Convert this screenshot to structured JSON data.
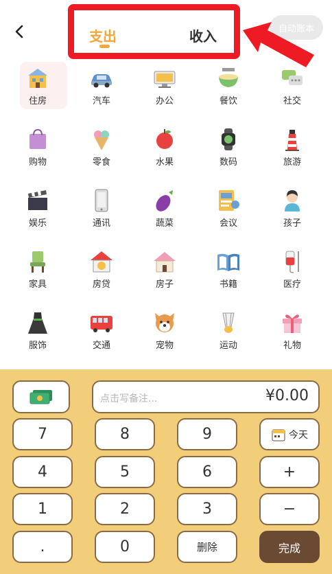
{
  "header": {
    "tabs": [
      {
        "label": "支出",
        "active": true
      },
      {
        "label": "收入",
        "active": false
      }
    ],
    "auto_button": "自动账本",
    "accent": "#f0a83a",
    "highlight_color": "#ee1b24"
  },
  "categories": [
    {
      "label": "住房",
      "icon": "house-icon",
      "selected": true
    },
    {
      "label": "汽车",
      "icon": "car-icon"
    },
    {
      "label": "办公",
      "icon": "computer-icon"
    },
    {
      "label": "餐饮",
      "icon": "noodle-bowl-icon"
    },
    {
      "label": "社交",
      "icon": "chat-bubbles-icon"
    },
    {
      "label": "购物",
      "icon": "shopping-bag-icon"
    },
    {
      "label": "零食",
      "icon": "ice-cream-icon"
    },
    {
      "label": "水果",
      "icon": "apple-icon"
    },
    {
      "label": "数码",
      "icon": "smartwatch-icon"
    },
    {
      "label": "旅游",
      "icon": "lighthouse-icon"
    },
    {
      "label": "娱乐",
      "icon": "clapperboard-icon"
    },
    {
      "label": "通讯",
      "icon": "phone-icon"
    },
    {
      "label": "蔬菜",
      "icon": "eggplant-icon"
    },
    {
      "label": "会议",
      "icon": "meeting-icon"
    },
    {
      "label": "孩子",
      "icon": "child-icon"
    },
    {
      "label": "家具",
      "icon": "chair-icon"
    },
    {
      "label": "房贷",
      "icon": "mortgage-house-icon"
    },
    {
      "label": "房子",
      "icon": "home-icon"
    },
    {
      "label": "书籍",
      "icon": "book-icon"
    },
    {
      "label": "医疗",
      "icon": "iv-drip-icon"
    },
    {
      "label": "服饰",
      "icon": "dress-icon"
    },
    {
      "label": "交通",
      "icon": "bus-icon"
    },
    {
      "label": "宠物",
      "icon": "dog-icon"
    },
    {
      "label": "运动",
      "icon": "shuttlecock-icon"
    },
    {
      "label": "礼物",
      "icon": "gift-icon"
    }
  ],
  "keypad": {
    "memo_placeholder": "点击写备注...",
    "amount": "¥0.00",
    "keys": {
      "k7": "7",
      "k8": "8",
      "k9": "9",
      "k4": "4",
      "k5": "5",
      "k6": "6",
      "k1": "1",
      "k2": "2",
      "k3": "3",
      "dot": ".",
      "k0": "0",
      "del": "删除",
      "today": "今天",
      "plus": "+",
      "minus": "−",
      "done": "完成"
    },
    "bg_color": "#f2cd7a",
    "done_color": "#6b4a34"
  }
}
